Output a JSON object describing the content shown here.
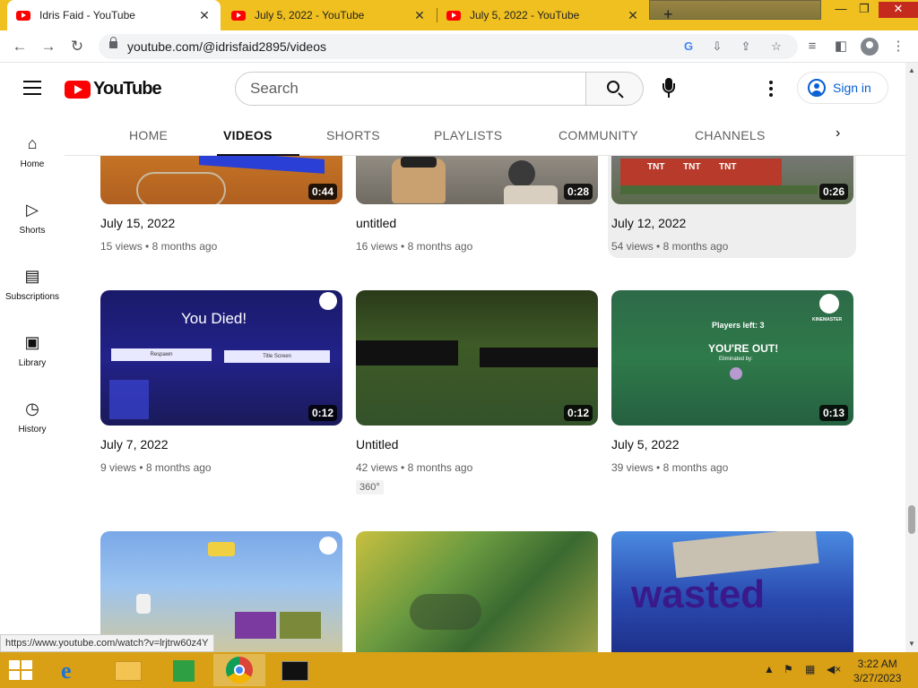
{
  "browser": {
    "tabs": [
      {
        "title": "Idris Faid - YouTube",
        "active": true
      },
      {
        "title": "July 5, 2022 - YouTube",
        "active": false
      },
      {
        "title": "July 5, 2022 - YouTube",
        "active": false
      }
    ],
    "new_tab_label": "+",
    "url": "youtube.com/@idrisfaid2895/videos",
    "status_url": "https://www.youtube.com/watch?v=lrjtrw60z4Y"
  },
  "youtube": {
    "logo_text": "YouTube",
    "search": {
      "placeholder": "Search",
      "value": ""
    },
    "signin_label": "Sign in",
    "guide": [
      {
        "label": "Home",
        "icon": "home-icon"
      },
      {
        "label": "Shorts",
        "icon": "shorts-icon"
      },
      {
        "label": "Subscriptions",
        "icon": "subscriptions-icon"
      },
      {
        "label": "Library",
        "icon": "library-icon"
      },
      {
        "label": "History",
        "icon": "history-icon"
      }
    ],
    "channel_tabs": [
      "HOME",
      "VIDEOS",
      "SHORTS",
      "PLAYLISTS",
      "COMMUNITY",
      "CHANNELS"
    ],
    "active_tab": "VIDEOS",
    "videos": [
      {
        "title": "July 15, 2022",
        "views": "15 views",
        "age": "8 months ago",
        "duration": "0:44"
      },
      {
        "title": "untitled",
        "views": "16 views",
        "age": "8 months ago",
        "duration": "0:28"
      },
      {
        "title": "July 12, 2022",
        "views": "54 views",
        "age": "8 months ago",
        "duration": "0:26"
      },
      {
        "title": "July 7, 2022",
        "views": "9 views",
        "age": "8 months ago",
        "duration": "0:12"
      },
      {
        "title": "Untitled",
        "views": "42 views",
        "age": "8 months ago",
        "duration": "0:12",
        "badge": "360°"
      },
      {
        "title": "July 5, 2022",
        "views": "39 views",
        "age": "8 months ago",
        "duration": "0:13"
      }
    ],
    "thumb_text": {
      "you_died": "You Died!",
      "respawn": "Respawn",
      "title_screen": "Title Screen",
      "players_left": "Players left: 3",
      "youre_out": "YOU'RE OUT!",
      "eliminated_by": "Eliminated by:",
      "tnt": "TNT",
      "wasted": "wasted",
      "kinemaster": "KINEMASTER"
    }
  },
  "taskbar": {
    "time": "3:22 AM",
    "date": "3/27/2023"
  },
  "colors": {
    "tabstrip": "#f0c020",
    "taskbar": "#d9a016",
    "youtube_red": "#ff0000",
    "signin_blue": "#065fd4"
  }
}
